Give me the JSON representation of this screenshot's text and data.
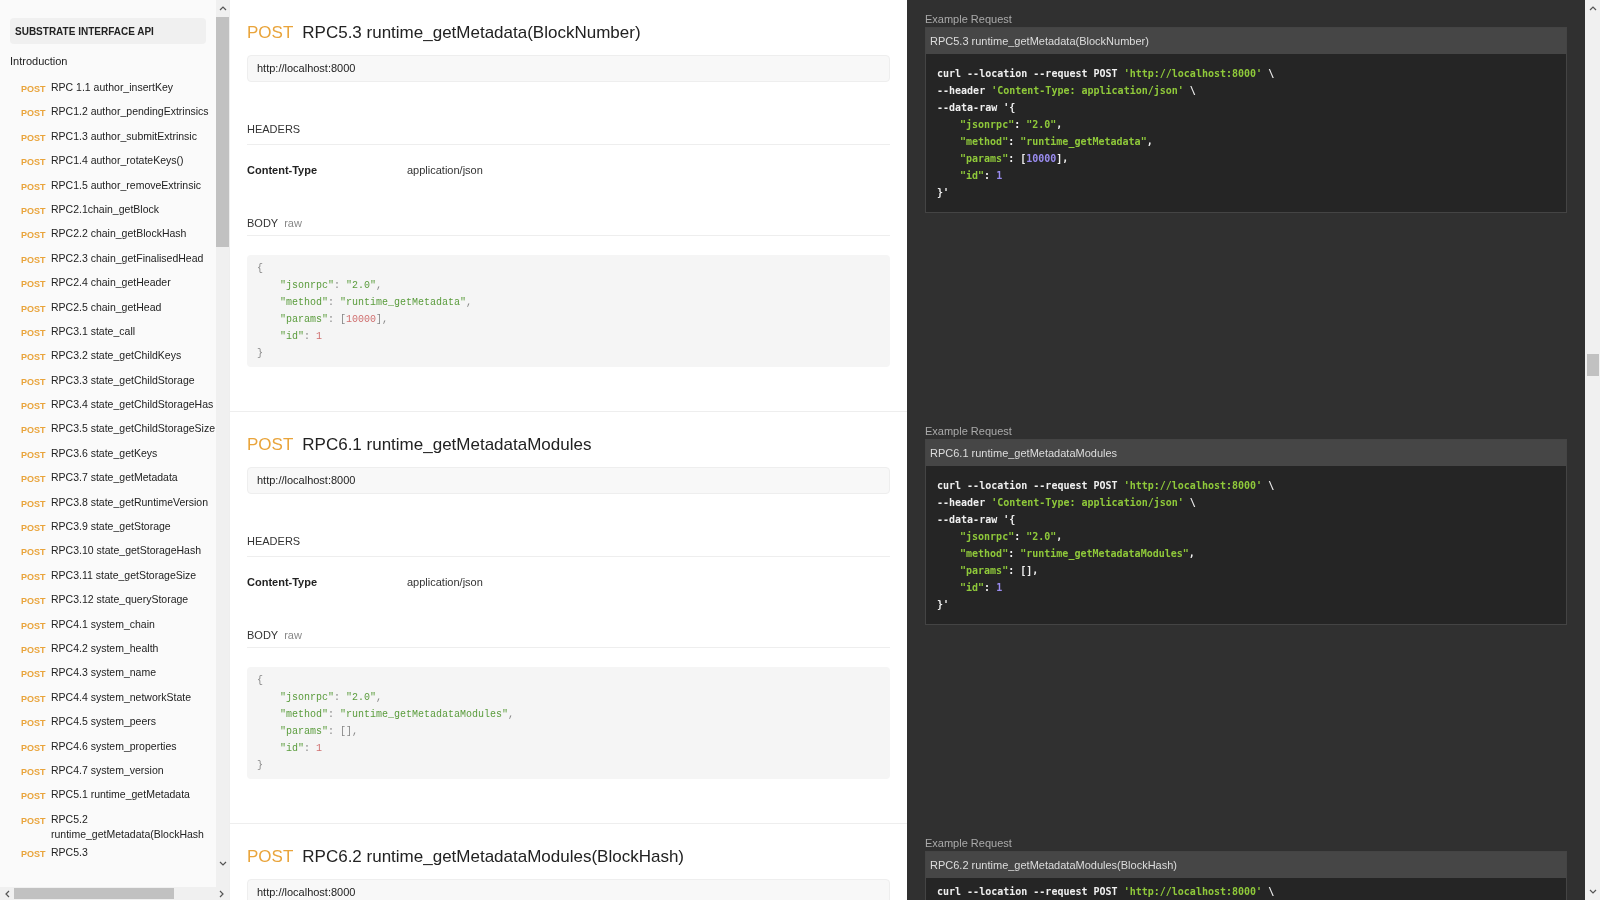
{
  "sidebar": {
    "title": "SUBSTRATE INTERFACE API",
    "intro": "Introduction",
    "items": [
      {
        "method": "POST",
        "label": "RPC 1.1 author_insertKey"
      },
      {
        "method": "POST",
        "label": "RPC1.2 author_pendingExtrinsics"
      },
      {
        "method": "POST",
        "label": "RPC1.3 author_submitExtrinsic"
      },
      {
        "method": "POST",
        "label": "RPC1.4 author_rotateKeys()"
      },
      {
        "method": "POST",
        "label": "RPC1.5 author_removeExtrinsic"
      },
      {
        "method": "POST",
        "label": "RPC2.1chain_getBlock"
      },
      {
        "method": "POST",
        "label": "RPC2.2 chain_getBlockHash"
      },
      {
        "method": "POST",
        "label": "RPC2.3 chain_getFinalisedHead"
      },
      {
        "method": "POST",
        "label": "RPC2.4 chain_getHeader"
      },
      {
        "method": "POST",
        "label": "RPC2.5 chain_getHead"
      },
      {
        "method": "POST",
        "label": "RPC3.1 state_call"
      },
      {
        "method": "POST",
        "label": "RPC3.2 state_getChildKeys"
      },
      {
        "method": "POST",
        "label": "RPC3.3 state_getChildStorage"
      },
      {
        "method": "POST",
        "label": "RPC3.4 state_getChildStorageHas"
      },
      {
        "method": "POST",
        "label": "RPC3.5 state_getChildStorageSize"
      },
      {
        "method": "POST",
        "label": "RPC3.6 state_getKeys"
      },
      {
        "method": "POST",
        "label": "RPC3.7 state_getMetadata"
      },
      {
        "method": "POST",
        "label": "RPC3.8 state_getRuntimeVersion"
      },
      {
        "method": "POST",
        "label": "RPC3.9 state_getStorage"
      },
      {
        "method": "POST",
        "label": "RPC3.10 state_getStorageHash"
      },
      {
        "method": "POST",
        "label": "RPC3.11 state_getStorageSize"
      },
      {
        "method": "POST",
        "label": "RPC3.12 state_queryStorage"
      },
      {
        "method": "POST",
        "label": "RPC4.1 system_chain"
      },
      {
        "method": "POST",
        "label": "RPC4.2 system_health"
      },
      {
        "method": "POST",
        "label": "RPC4.3 system_name"
      },
      {
        "method": "POST",
        "label": "RPC4.4 system_networkState"
      },
      {
        "method": "POST",
        "label": "RPC4.5 system_peers"
      },
      {
        "method": "POST",
        "label": "RPC4.6 system_properties"
      },
      {
        "method": "POST",
        "label": "RPC4.7 system_version"
      },
      {
        "method": "POST",
        "label": "RPC5.1 runtime_getMetadata"
      },
      {
        "method": "POST",
        "label": "RPC5.2 runtime_getMetadata(BlockHash"
      },
      {
        "method": "POST",
        "label": "RPC5.3"
      }
    ]
  },
  "sections": [
    {
      "method": "POST",
      "title": "RPC5.3 runtime_getMetadata(BlockNumber)",
      "url": "http://localhost:8000",
      "headers_label": "HEADERS",
      "headers": [
        {
          "name": "Content-Type",
          "value": "application/json"
        }
      ],
      "body_label": "BODY",
      "body_mode": "raw",
      "body": [
        {
          "nested": false,
          "tokens": [
            {
              "kind": "punct",
              "text": "{"
            }
          ]
        },
        {
          "nested": true,
          "tokens": [
            {
              "kind": "key",
              "text": "\"jsonrpc\""
            },
            {
              "kind": "punct",
              "text": ": "
            },
            {
              "kind": "string",
              "text": "\"2.0\""
            },
            {
              "kind": "punct",
              "text": ","
            }
          ]
        },
        {
          "nested": true,
          "tokens": [
            {
              "kind": "key",
              "text": "\"method\""
            },
            {
              "kind": "punct",
              "text": ": "
            },
            {
              "kind": "string",
              "text": "\"runtime_getMetadata\""
            },
            {
              "kind": "punct",
              "text": ","
            }
          ]
        },
        {
          "nested": true,
          "tokens": [
            {
              "kind": "key",
              "text": "\"params\""
            },
            {
              "kind": "punct",
              "text": ": ["
            },
            {
              "kind": "number",
              "text": "10000"
            },
            {
              "kind": "punct",
              "text": "],"
            }
          ]
        },
        {
          "nested": true,
          "tokens": [
            {
              "kind": "key",
              "text": "\"id\""
            },
            {
              "kind": "punct",
              "text": ": "
            },
            {
              "kind": "number",
              "text": "1"
            }
          ]
        },
        {
          "nested": false,
          "tokens": [
            {
              "kind": "punct",
              "text": "}"
            }
          ]
        }
      ],
      "example": {
        "label": "Example Request",
        "title": "RPC5.3 runtime_getMetadata(BlockNumber)",
        "code": [
          {
            "nested": false,
            "tokens": [
              {
                "kind": "punct",
                "text": "curl --location --request POST "
              },
              {
                "kind": "string",
                "text": "'http://localhost:8000'"
              },
              {
                "kind": "punct",
                "text": " \\"
              }
            ]
          },
          {
            "nested": false,
            "tokens": [
              {
                "kind": "punct",
                "text": "--header "
              },
              {
                "kind": "string",
                "text": "'Content-Type: application/json'"
              },
              {
                "kind": "punct",
                "text": " \\"
              }
            ]
          },
          {
            "nested": false,
            "tokens": [
              {
                "kind": "punct",
                "text": "--data-raw '{"
              }
            ]
          },
          {
            "nested": true,
            "tokens": [
              {
                "kind": "key",
                "text": "\"jsonrpc\""
              },
              {
                "kind": "punct",
                "text": ": "
              },
              {
                "kind": "string",
                "text": "\"2.0\""
              },
              {
                "kind": "punct",
                "text": ","
              }
            ]
          },
          {
            "nested": true,
            "tokens": [
              {
                "kind": "key",
                "text": "\"method\""
              },
              {
                "kind": "punct",
                "text": ": "
              },
              {
                "kind": "string",
                "text": "\"runtime_getMetadata\""
              },
              {
                "kind": "punct",
                "text": ","
              }
            ]
          },
          {
            "nested": true,
            "tokens": [
              {
                "kind": "key",
                "text": "\"params\""
              },
              {
                "kind": "punct",
                "text": ": ["
              },
              {
                "kind": "number",
                "text": "10000"
              },
              {
                "kind": "punct",
                "text": "],"
              }
            ]
          },
          {
            "nested": true,
            "tokens": [
              {
                "kind": "key",
                "text": "\"id\""
              },
              {
                "kind": "punct",
                "text": ": "
              },
              {
                "kind": "number",
                "text": "1"
              }
            ]
          },
          {
            "nested": false,
            "tokens": [
              {
                "kind": "punct",
                "text": "}'"
              }
            ]
          }
        ]
      }
    },
    {
      "method": "POST",
      "title": "RPC6.1 runtime_getMetadataModules",
      "url": "http://localhost:8000",
      "headers_label": "HEADERS",
      "headers": [
        {
          "name": "Content-Type",
          "value": "application/json"
        }
      ],
      "body_label": "BODY",
      "body_mode": "raw",
      "body": [
        {
          "nested": false,
          "tokens": [
            {
              "kind": "punct",
              "text": "{"
            }
          ]
        },
        {
          "nested": true,
          "tokens": [
            {
              "kind": "key",
              "text": "\"jsonrpc\""
            },
            {
              "kind": "punct",
              "text": ": "
            },
            {
              "kind": "string",
              "text": "\"2.0\""
            },
            {
              "kind": "punct",
              "text": ","
            }
          ]
        },
        {
          "nested": true,
          "tokens": [
            {
              "kind": "key",
              "text": "\"method\""
            },
            {
              "kind": "punct",
              "text": ": "
            },
            {
              "kind": "string",
              "text": "\"runtime_getMetadataModules\""
            },
            {
              "kind": "punct",
              "text": ","
            }
          ]
        },
        {
          "nested": true,
          "tokens": [
            {
              "kind": "key",
              "text": "\"params\""
            },
            {
              "kind": "punct",
              "text": ": [],"
            }
          ]
        },
        {
          "nested": true,
          "tokens": [
            {
              "kind": "key",
              "text": "\"id\""
            },
            {
              "kind": "punct",
              "text": ": "
            },
            {
              "kind": "number",
              "text": "1"
            }
          ]
        },
        {
          "nested": false,
          "tokens": [
            {
              "kind": "punct",
              "text": "}"
            }
          ]
        }
      ],
      "example": {
        "label": "Example Request",
        "title": "RPC6.1 runtime_getMetadataModules",
        "code": [
          {
            "nested": false,
            "tokens": [
              {
                "kind": "punct",
                "text": "curl --location --request POST "
              },
              {
                "kind": "string",
                "text": "'http://localhost:8000'"
              },
              {
                "kind": "punct",
                "text": " \\"
              }
            ]
          },
          {
            "nested": false,
            "tokens": [
              {
                "kind": "punct",
                "text": "--header "
              },
              {
                "kind": "string",
                "text": "'Content-Type: application/json'"
              },
              {
                "kind": "punct",
                "text": " \\"
              }
            ]
          },
          {
            "nested": false,
            "tokens": [
              {
                "kind": "punct",
                "text": "--data-raw '{"
              }
            ]
          },
          {
            "nested": true,
            "tokens": [
              {
                "kind": "key",
                "text": "\"jsonrpc\""
              },
              {
                "kind": "punct",
                "text": ": "
              },
              {
                "kind": "string",
                "text": "\"2.0\""
              },
              {
                "kind": "punct",
                "text": ","
              }
            ]
          },
          {
            "nested": true,
            "tokens": [
              {
                "kind": "key",
                "text": "\"method\""
              },
              {
                "kind": "punct",
                "text": ": "
              },
              {
                "kind": "string",
                "text": "\"runtime_getMetadataModules\""
              },
              {
                "kind": "punct",
                "text": ","
              }
            ]
          },
          {
            "nested": true,
            "tokens": [
              {
                "kind": "key",
                "text": "\"params\""
              },
              {
                "kind": "punct",
                "text": ": [],"
              }
            ]
          },
          {
            "nested": true,
            "tokens": [
              {
                "kind": "key",
                "text": "\"id\""
              },
              {
                "kind": "punct",
                "text": ": "
              },
              {
                "kind": "number",
                "text": "1"
              }
            ]
          },
          {
            "nested": false,
            "tokens": [
              {
                "kind": "punct",
                "text": "}'"
              }
            ]
          }
        ]
      }
    },
    {
      "method": "POST",
      "title": "RPC6.2 runtime_getMetadataModules(BlockHash)",
      "url": "http://localhost:8000",
      "example": {
        "label": "Example Request",
        "title": "RPC6.2 runtime_getMetadataModules(BlockHash)",
        "code": [
          {
            "nested": false,
            "tokens": [
              {
                "kind": "punct",
                "text": "curl --location --request POST "
              },
              {
                "kind": "string",
                "text": "'http://localhost:8000'"
              },
              {
                "kind": "punct",
                "text": " \\"
              }
            ]
          }
        ]
      }
    }
  ]
}
